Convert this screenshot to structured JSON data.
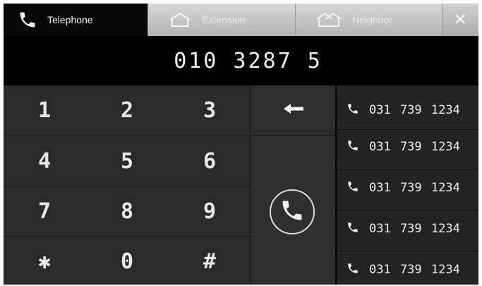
{
  "tabs": {
    "telephone": {
      "label": "Telephone",
      "icon": "phone-icon"
    },
    "extension": {
      "label": "Extension",
      "icon": "house-outline-icon"
    },
    "neighbor": {
      "label": "Neighbor",
      "icon": "neighbor-houses-icon"
    },
    "close": {
      "label": "✕",
      "icon": "close-icon"
    }
  },
  "display": {
    "number": "010 3287 5"
  },
  "keypad": {
    "keys": [
      "1",
      "2",
      "3",
      "4",
      "5",
      "6",
      "7",
      "8",
      "9",
      "✱",
      "0",
      "#"
    ]
  },
  "actions": {
    "backspace_icon": "backspace-arrow-icon",
    "call_icon": "phone-call-icon"
  },
  "recent": {
    "items": [
      {
        "number": "031 739 1234"
      },
      {
        "number": "031 739 1234"
      },
      {
        "number": "031 739 1234"
      },
      {
        "number": "031 739 1234"
      },
      {
        "number": "031 739 1234"
      }
    ]
  }
}
